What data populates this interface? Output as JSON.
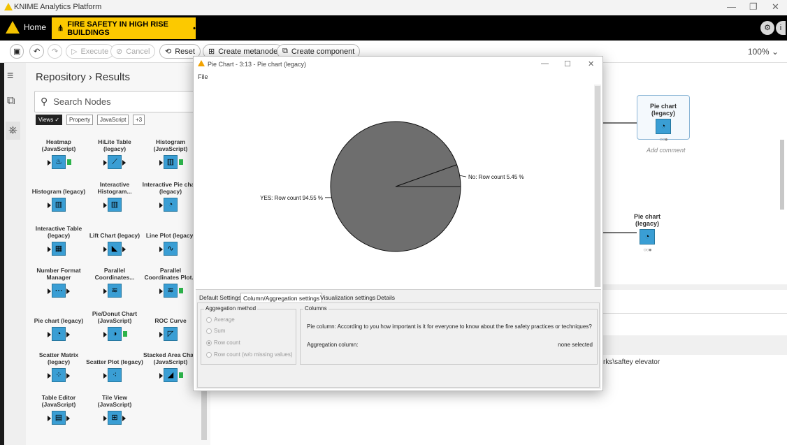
{
  "app": {
    "title": "KNIME Analytics Platform"
  },
  "tabs": {
    "home": "Home",
    "workflow": "FIRE SAFETY IN HIGH RISE BUILDINGS",
    "dirty_mark": "•"
  },
  "toolbar": {
    "execute": "Execute",
    "cancel": "Cancel",
    "reset": "Reset",
    "create_metanode": "Create metanode",
    "create_component": "Create component",
    "zoom": "100%"
  },
  "repository": {
    "breadcrumb": "Repository › Results",
    "search_placeholder": "Search Nodes",
    "tags": [
      "Views",
      "Property",
      "JavaScript",
      "+3"
    ],
    "nodes": [
      {
        "label": "Heatmap (JavaScript)"
      },
      {
        "label": "HiLite Table (legacy)"
      },
      {
        "label": "Histogram (JavaScript)"
      },
      {
        "label": "Histogram (legacy)"
      },
      {
        "label": "Interactive Histogram..."
      },
      {
        "label": "Interactive Pie chart (legacy)"
      },
      {
        "label": "Interactive Table (legacy)"
      },
      {
        "label": "Lift Chart (legacy)"
      },
      {
        "label": "Line Plot (legacy)"
      },
      {
        "label": "Number Format Manager"
      },
      {
        "label": "Parallel Coordinates..."
      },
      {
        "label": "Parallel Coordinates Plot..."
      },
      {
        "label": "Pie chart (legacy)"
      },
      {
        "label": "Pie/Donut Chart (JavaScript)"
      },
      {
        "label": "ROC Curve"
      },
      {
        "label": "Scatter Matrix (legacy)"
      },
      {
        "label": "Scatter Plot (legacy)"
      },
      {
        "label": "Stacked Area Chart (JavaScript)"
      },
      {
        "label": "Table Editor (JavaScript)"
      },
      {
        "label": "Tile View (JavaScript)"
      }
    ]
  },
  "canvas": {
    "node1_label": "Pie chart (legacy)",
    "node1_comment": "Add comment",
    "node2_label": "Pie chart (legacy)",
    "path_text": "rks\\saftey elevator"
  },
  "dialog": {
    "title": "Pie Chart - 3:13 - Pie chart (legacy)",
    "menu": "File",
    "tabs": [
      "Default Settings",
      "Column/Aggregation settings",
      "Visualization settings",
      "Details"
    ],
    "aggregation_title": "Aggregation method",
    "aggregation_options": [
      "Average",
      "Sum",
      "Row count",
      "Row count (w/o missing values)"
    ],
    "selected_aggregation": "Row count",
    "columns_title": "Columns",
    "pie_column": "Pie column: According to you how important is it for everyone to know about the fire safety practices or techniques?",
    "aggregation_column_label": "Aggregation column:",
    "aggregation_column_value": "none selected"
  },
  "chart_data": {
    "type": "pie",
    "categories": [
      "YES",
      "No"
    ],
    "values": [
      94.55,
      5.45
    ],
    "labels": [
      "YES: Row count 94.55 %",
      "No: Row count 5.45 %"
    ],
    "colors": [
      "#6e6e6e",
      "#6e6e6e"
    ]
  }
}
